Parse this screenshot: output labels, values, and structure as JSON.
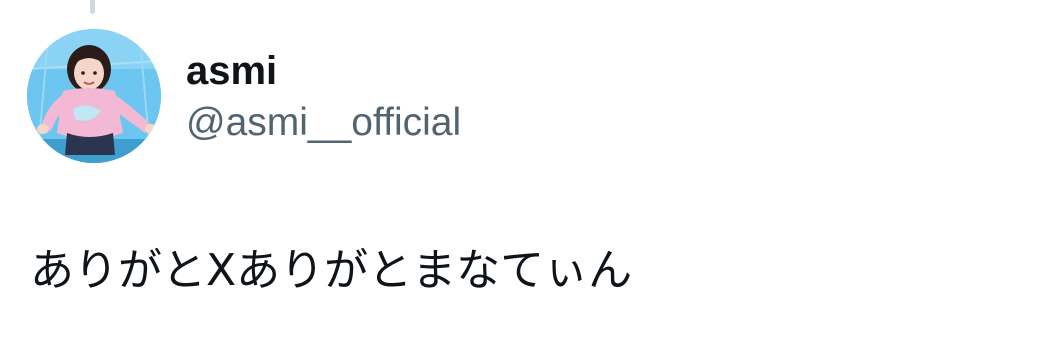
{
  "user": {
    "display_name": "asmi",
    "handle": "@asmi__official"
  },
  "tweet": {
    "text": "ありがとXありがとまなてぃん"
  }
}
